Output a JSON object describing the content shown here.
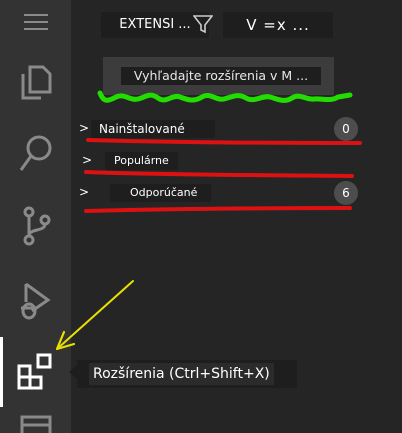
{
  "colors": {
    "activity_bar": "#333333",
    "sidebar": "#252526",
    "annotation_green": "#22dd00",
    "annotation_red": "#dd1111",
    "annotation_yellow": "#e8e000"
  },
  "activity_bar": {
    "items": [
      {
        "icon": "files-icon",
        "label": ""
      },
      {
        "icon": "search-icon",
        "label": ""
      },
      {
        "icon": "source-control-icon",
        "label": ""
      },
      {
        "icon": "run-debug-icon",
        "label": ""
      },
      {
        "icon": "extensions-icon",
        "label": "",
        "active": true
      },
      {
        "icon": "accounts-icon",
        "label": ""
      }
    ],
    "menu_icon": "hamburger-icon"
  },
  "header": {
    "title": "EXTENSI ...",
    "filter_icon": "filter-icon",
    "view_menu": "V =x ..."
  },
  "search": {
    "placeholder": "Vyhľadajte rozšírenia v M ..."
  },
  "sections": [
    {
      "label": "Nainštalované",
      "count": "0",
      "chevron": ">"
    },
    {
      "label": "Populárne",
      "count": "",
      "chevron": ">"
    },
    {
      "label": "Odporúčané",
      "count": "6",
      "chevron": ">"
    }
  ],
  "tooltip": {
    "text": "Rozšírenia (Ctrl+Shift+X)"
  }
}
